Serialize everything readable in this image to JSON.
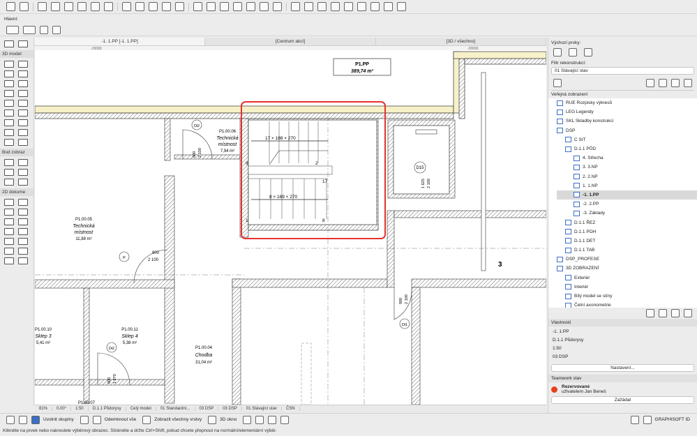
{
  "toolbar": {
    "mode_label": "Hlavní:"
  },
  "tabs": [
    {
      "label": "-1. 1.PP [-1. 1.PP]",
      "active": true
    },
    {
      "label": "[Centrum akcí]",
      "active": false
    },
    {
      "label": "[3D / všechno]",
      "active": false
    }
  ],
  "left_sections": {
    "model3d": "3D model",
    "bod": "Bod zobraz",
    "dok2d": "2D dokume"
  },
  "ruler": {
    "left": "-15000",
    "right": "-20000"
  },
  "plan": {
    "title_box": {
      "line1": "P1.PP",
      "line2": "389,74 m²"
    },
    "rooms": [
      {
        "id": "P1.00.06",
        "name1": "Technická",
        "name2": "místnost",
        "area": "7,94 m²"
      },
      {
        "id": "P1.00.05",
        "name1": "Technická",
        "name2": "místnost",
        "area": "11,88 m²"
      },
      {
        "id": "P1.00.04",
        "name1": "Chodba",
        "area": "31,04 m²"
      },
      {
        "id": "P1.00.11",
        "name1": "Sklep 4",
        "area": "5,38 m²"
      },
      {
        "id": "P1.00.10",
        "name1": "Sklep 3",
        "area": "5,41 m²"
      },
      {
        "id": "P1.00.07"
      }
    ],
    "doors": [
      {
        "tag": "Di2",
        "w": "800",
        "h": "2 100"
      },
      {
        "tag": "D15"
      },
      {
        "tag": "Di1",
        "w": "900",
        "h": "2 100"
      },
      {
        "tag": "P",
        "w": "900",
        "h": "2 100"
      },
      {
        "tag": "Di2",
        "w": "800",
        "h": "1 970"
      }
    ],
    "stair_upper": "17 × 188 × 270",
    "stair_lower": "8 × 169 × 270",
    "stair_num_upper": "9",
    "stair_num_mid": "2",
    "stair_num_right": "17",
    "stair_num_low1": "1",
    "stair_num_low2": "8",
    "elevator_dims": "1 625",
    "elevator_dims2": "2 100",
    "marker": "3"
  },
  "right_panel": {
    "default_elements": "Výchozí prvky:",
    "filter_label": "Filtr rekonstrukcí:",
    "filter_value": "01 Stávající stav",
    "public_view": "Veřejná zobrazení",
    "tree": [
      {
        "label": "RUE Rozpisky výkresů",
        "indent": 0
      },
      {
        "label": "LEG Legendy",
        "indent": 0
      },
      {
        "label": "SKL Skladby konstrukcí",
        "indent": 0
      },
      {
        "label": "DSP",
        "indent": 0
      },
      {
        "label": "C SIT",
        "indent": 1
      },
      {
        "label": "D.1.1 PŮD",
        "indent": 1
      },
      {
        "label": "4. Střecha",
        "indent": 2
      },
      {
        "label": "3. 3.NP",
        "indent": 2
      },
      {
        "label": "2. 2.NP",
        "indent": 2
      },
      {
        "label": "1. 1.NP",
        "indent": 2
      },
      {
        "label": "-1. 1.PP",
        "indent": 2,
        "hl": true
      },
      {
        "label": "-2. 2.PP",
        "indent": 2
      },
      {
        "label": "-3. Základy",
        "indent": 2
      },
      {
        "label": "D.1.1 ŘEZ",
        "indent": 1
      },
      {
        "label": "D.1.1 POH",
        "indent": 1
      },
      {
        "label": "D.1.1 DET",
        "indent": 1
      },
      {
        "label": "D.1.1 TAB",
        "indent": 1
      },
      {
        "label": "DSP_PROFESE",
        "indent": 0
      },
      {
        "label": "3D ZOBRAZENÍ",
        "indent": 0
      },
      {
        "label": "Exteriér",
        "indent": 1
      },
      {
        "label": "Interiér",
        "indent": 1
      },
      {
        "label": "Bílý model se stíny",
        "indent": 1
      },
      {
        "label": "Čelní axonometrie",
        "indent": 1
      }
    ],
    "props_title": "Vlastnosti",
    "props": [
      "-1. 1.PP",
      "D.1.1 Půdorysy",
      "1:50",
      "03 DSP"
    ],
    "settings_btn": "Nastavení...",
    "teamwork_title": "Teamwork stav",
    "teamwork_status": "Rezervované",
    "teamwork_user": "uživatelem Jan Beneš",
    "request_btn": "Zažádat"
  },
  "status_bar": [
    "81%",
    "0,00°",
    "1:50",
    "D.1.1 Půdorysy",
    "Celý model",
    "01 Standardní...",
    "03 DSP",
    "03 DSP",
    "01 Stávající stav",
    "ČSN"
  ],
  "bottom_toolbar": {
    "ungroup": "Uvolnit skupiny",
    "unlock_all": "Odemknout vše",
    "show_layers": "Zobrazit všechny vrstvy",
    "window3d": "3D okno",
    "brand": "GRAPHISOFT ID"
  },
  "hint_text": "Klikněte na prvek nebo nakreslete výběrový obrazec. Stiskněte a držte Ctrl+Shift, pokud chcete přepnout na normální/elementární výběr."
}
